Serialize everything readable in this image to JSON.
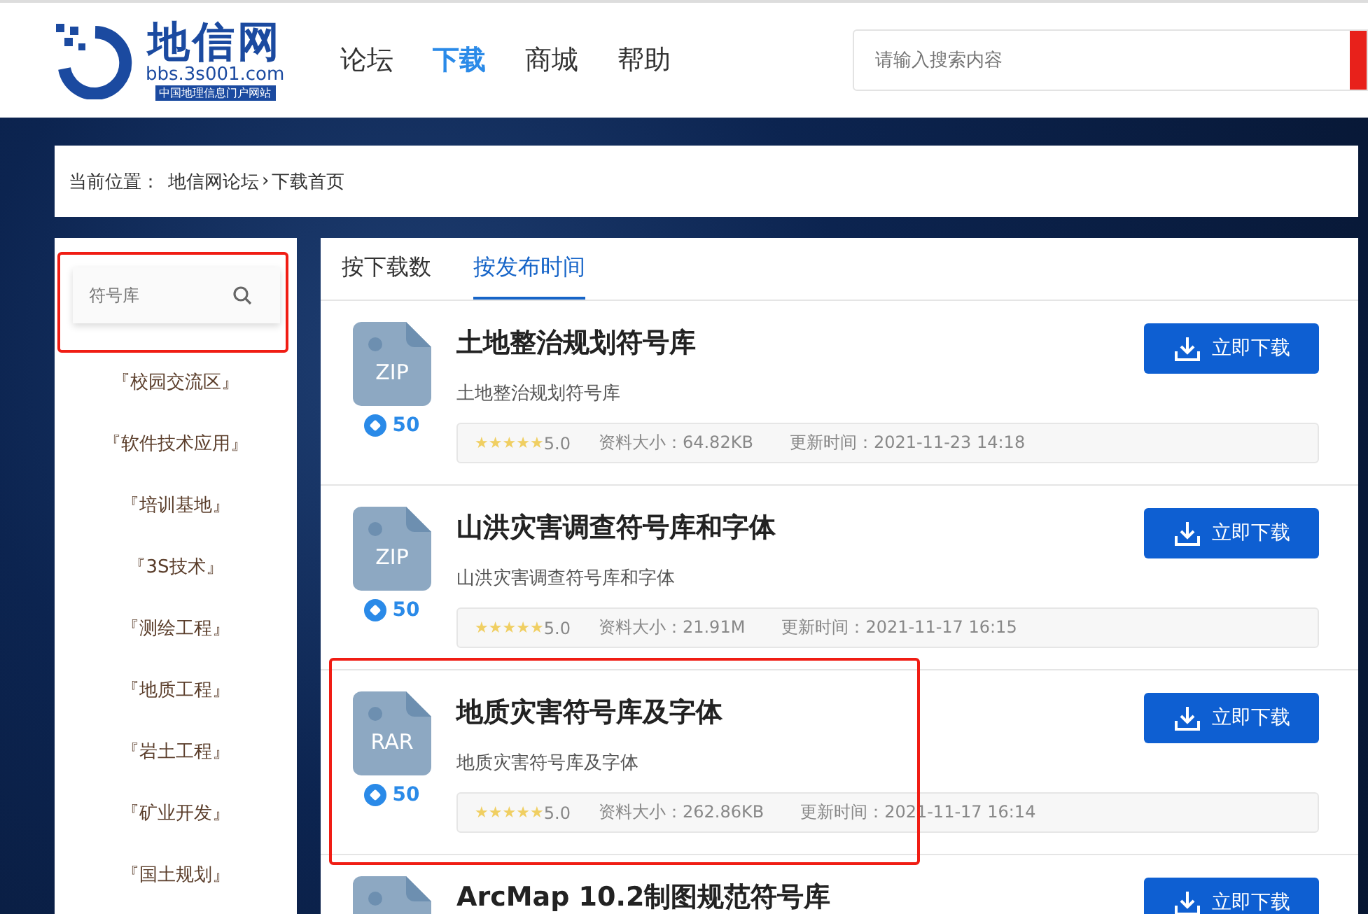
{
  "header": {
    "logo_title": "地信网",
    "logo_url": "bbs.3s001.com",
    "logo_tagline": "中国地理信息门户网站",
    "nav": [
      {
        "label": "论坛",
        "selected": false
      },
      {
        "label": "下载",
        "selected": true
      },
      {
        "label": "商城",
        "selected": false
      },
      {
        "label": "帮助",
        "selected": false
      }
    ],
    "search": {
      "placeholder": "请输入搜索内容"
    }
  },
  "breadcrumb": {
    "label": "当前位置：",
    "links": [
      "地信网论坛",
      "下载首页"
    ],
    "separator": "›"
  },
  "sidebar": {
    "search": {
      "placeholder": "符号库",
      "highlighted": true
    },
    "items": [
      "『校园交流区』",
      "『软件技术应用』",
      "『培训基地』",
      "『3S技术』",
      "『测绘工程』",
      "『地质工程』",
      "『岩土工程』",
      "『矿业开发』",
      "『国土规划』"
    ]
  },
  "tabs": [
    {
      "label": "按下载数",
      "selected": false
    },
    {
      "label": "按发布时间",
      "selected": true
    }
  ],
  "items": [
    {
      "title": "土地整治规划符号库",
      "description": "土地整治规划符号库",
      "file_type": "ZIP",
      "points": "50",
      "stars": 5,
      "rating": "5.0",
      "size": "资料大小：64.82KB",
      "updated": "更新时间：2021-11-23 14:18",
      "button": "立即下载",
      "highlighted": false
    },
    {
      "title": "山洪灾害调查符号库和字体",
      "description": "山洪灾害调查符号库和字体",
      "file_type": "ZIP",
      "points": "50",
      "stars": 5,
      "rating": "5.0",
      "size": "资料大小：21.91M",
      "updated": "更新时间：2021-11-17 16:15",
      "button": "立即下载",
      "highlighted": false
    },
    {
      "title": "地质灾害符号库及字体",
      "description": "地质灾害符号库及字体",
      "file_type": "RAR",
      "points": "50",
      "stars": 5,
      "rating": "5.0",
      "size": "资料大小：262.86KB",
      "updated": "更新时间：2021-11-17 16:14",
      "button": "立即下载",
      "highlighted": true
    },
    {
      "title": "ArcMap 10.2制图规范符号库",
      "button": "立即下载",
      "highlighted": false
    }
  ]
}
